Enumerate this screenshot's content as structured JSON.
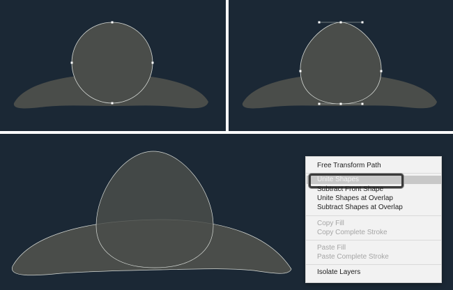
{
  "colors": {
    "canvas_bg": "#1b2835",
    "shape_fill": "#4a4d4a",
    "path_stroke": "#d8dcd8",
    "menu_bg": "#f2f2f2",
    "menu_text": "#222222",
    "menu_disabled_text": "#a5a5a5",
    "menu_highlight": "#c8c8c8"
  },
  "context_menu": {
    "items": [
      {
        "label": "Free Transform Path",
        "enabled": true
      },
      {
        "label": "Unite Shapes",
        "enabled": true,
        "highlighted": true
      },
      {
        "label": "Subtract Front Shape",
        "enabled": true
      },
      {
        "label": "Unite Shapes at Overlap",
        "enabled": true
      },
      {
        "label": "Subtract Shapes at Overlap",
        "enabled": true
      },
      {
        "label": "Copy Fill",
        "enabled": false
      },
      {
        "label": "Copy Complete Stroke",
        "enabled": false
      },
      {
        "label": "Paste Fill",
        "enabled": false
      },
      {
        "label": "Paste Complete Stroke",
        "enabled": false
      },
      {
        "label": "Isolate Layers",
        "enabled": true
      }
    ]
  }
}
